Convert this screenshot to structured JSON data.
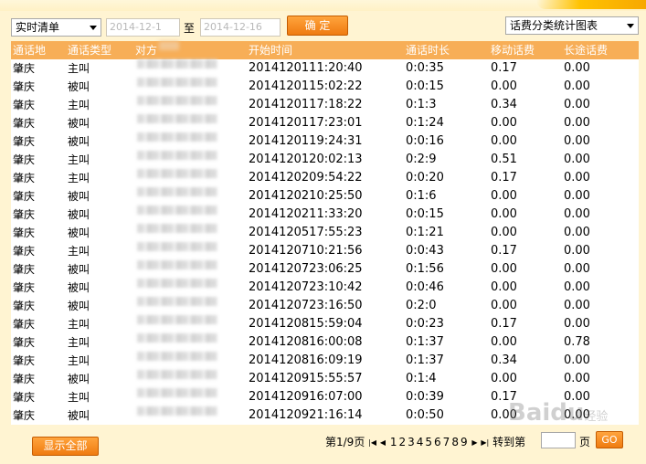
{
  "toolbar": {
    "list_type": "实时清单",
    "start_date": "2014-12-1",
    "to_label": "至",
    "end_date": "2014-12-16",
    "confirm_label": "确 定",
    "chart_select": "话费分类统计图表"
  },
  "table": {
    "headers": [
      "通话地",
      "通话类型",
      "对方",
      "开始时间",
      "通话时长",
      "移动话费",
      "长途话费"
    ],
    "rows": [
      [
        "肇庆",
        "主叫",
        "2014120111:20:40",
        "0:0:35",
        "0.17",
        "0.00"
      ],
      [
        "肇庆",
        "被叫",
        "2014120115:02:22",
        "0:0:15",
        "0.00",
        "0.00"
      ],
      [
        "肇庆",
        "主叫",
        "2014120117:18:22",
        "0:1:3",
        "0.34",
        "0.00"
      ],
      [
        "肇庆",
        "被叫",
        "2014120117:23:01",
        "0:1:24",
        "0.00",
        "0.00"
      ],
      [
        "肇庆",
        "被叫",
        "2014120119:24:31",
        "0:0:16",
        "0.00",
        "0.00"
      ],
      [
        "肇庆",
        "主叫",
        "2014120120:02:13",
        "0:2:9",
        "0.51",
        "0.00"
      ],
      [
        "肇庆",
        "主叫",
        "2014120209:54:22",
        "0:0:20",
        "0.17",
        "0.00"
      ],
      [
        "肇庆",
        "被叫",
        "2014120210:25:50",
        "0:1:6",
        "0.00",
        "0.00"
      ],
      [
        "肇庆",
        "被叫",
        "2014120211:33:20",
        "0:0:15",
        "0.00",
        "0.00"
      ],
      [
        "肇庆",
        "被叫",
        "2014120517:55:23",
        "0:1:21",
        "0.00",
        "0.00"
      ],
      [
        "肇庆",
        "主叫",
        "2014120710:21:56",
        "0:0:43",
        "0.17",
        "0.00"
      ],
      [
        "肇庆",
        "被叫",
        "2014120723:06:25",
        "0:1:56",
        "0.00",
        "0.00"
      ],
      [
        "肇庆",
        "被叫",
        "2014120723:10:42",
        "0:0:46",
        "0.00",
        "0.00"
      ],
      [
        "肇庆",
        "被叫",
        "2014120723:16:50",
        "0:2:0",
        "0.00",
        "0.00"
      ],
      [
        "肇庆",
        "主叫",
        "2014120815:59:04",
        "0:0:23",
        "0.17",
        "0.00"
      ],
      [
        "肇庆",
        "主叫",
        "2014120816:00:08",
        "0:1:37",
        "0.00",
        "0.78"
      ],
      [
        "肇庆",
        "主叫",
        "2014120816:09:19",
        "0:1:37",
        "0.34",
        "0.00"
      ],
      [
        "肇庆",
        "被叫",
        "2014120915:55:57",
        "0:1:4",
        "0.00",
        "0.00"
      ],
      [
        "肇庆",
        "主叫",
        "2014120916:07:00",
        "0:0:39",
        "0.17",
        "0.00"
      ],
      [
        "肇庆",
        "被叫",
        "2014120921:16:14",
        "0:0:50",
        "0.00",
        "0.00"
      ]
    ]
  },
  "footer": {
    "show_all_label": "显示全部",
    "page_info": "第1/9页",
    "pages": [
      "1",
      "2",
      "3",
      "4",
      "5",
      "6",
      "7",
      "8",
      "9"
    ],
    "goto_label": "转到第",
    "page_unit": "页",
    "go_label": "GO"
  },
  "watermark": {
    "brand": "Bai",
    "paw": "du",
    "suffix": "经验"
  }
}
